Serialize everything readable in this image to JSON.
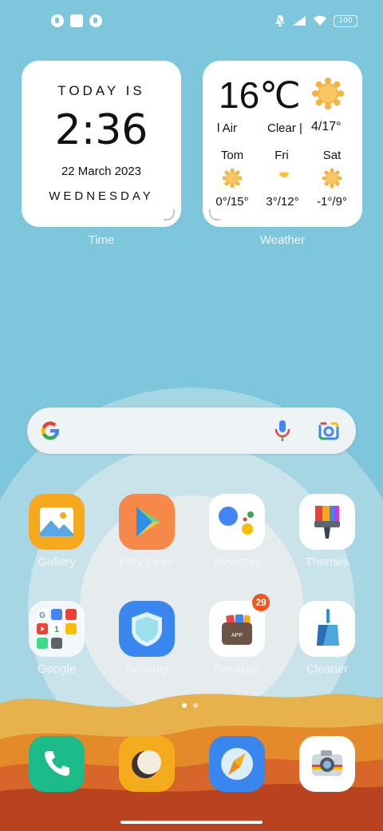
{
  "status_bar": {
    "battery_level": "100",
    "icons": [
      "app-notification-icon",
      "square-notification-icon",
      "app-notification-icon",
      "notification-bell-muted-icon",
      "cellular-signal-icon",
      "wifi-icon",
      "battery-icon"
    ]
  },
  "time_widget": {
    "heading": "TODAY IS",
    "clock": "2:36",
    "date": "22 March 2023",
    "weekday": "WEDNESDAY",
    "caption": "Time"
  },
  "weather_widget": {
    "temperature": "16℃",
    "air_quality_label": "l Air",
    "condition": "Clear |",
    "today_range": "4/17°",
    "forecast": [
      {
        "day": "Tom",
        "range": "0°/15°",
        "icon": "sunny-icon"
      },
      {
        "day": "Fri",
        "range": "3°/12°",
        "icon": "partly-sunny-icon"
      },
      {
        "day": "Sat",
        "range": "-1°/9°",
        "icon": "sunny-icon"
      }
    ],
    "caption": "Weather"
  },
  "search": {
    "icons": [
      "google-logo-icon",
      "microphone-icon",
      "lens-camera-icon"
    ]
  },
  "apps": [
    {
      "label": "Gallery",
      "icon": "gallery-icon"
    },
    {
      "label": "Play Store",
      "icon": "play-store-icon"
    },
    {
      "label": "Assistant",
      "icon": "assistant-icon"
    },
    {
      "label": "Themes",
      "icon": "themes-icon"
    },
    {
      "label": "Google",
      "icon": "google-folder-icon"
    },
    {
      "label": "Security",
      "icon": "security-icon"
    },
    {
      "label": "GetApps",
      "icon": "getapps-icon",
      "badge": "29"
    },
    {
      "label": "Cleaner",
      "icon": "cleaner-icon"
    }
  ],
  "dock": [
    {
      "icon": "phone-icon"
    },
    {
      "icon": "messaging-icon"
    },
    {
      "icon": "browser-icon"
    },
    {
      "icon": "camera-icon"
    }
  ],
  "colors": {
    "sky": "#7ec6dc",
    "badge": "#f0561d",
    "dune_orange": "#e78a2c",
    "dune_red": "#c14c24"
  }
}
